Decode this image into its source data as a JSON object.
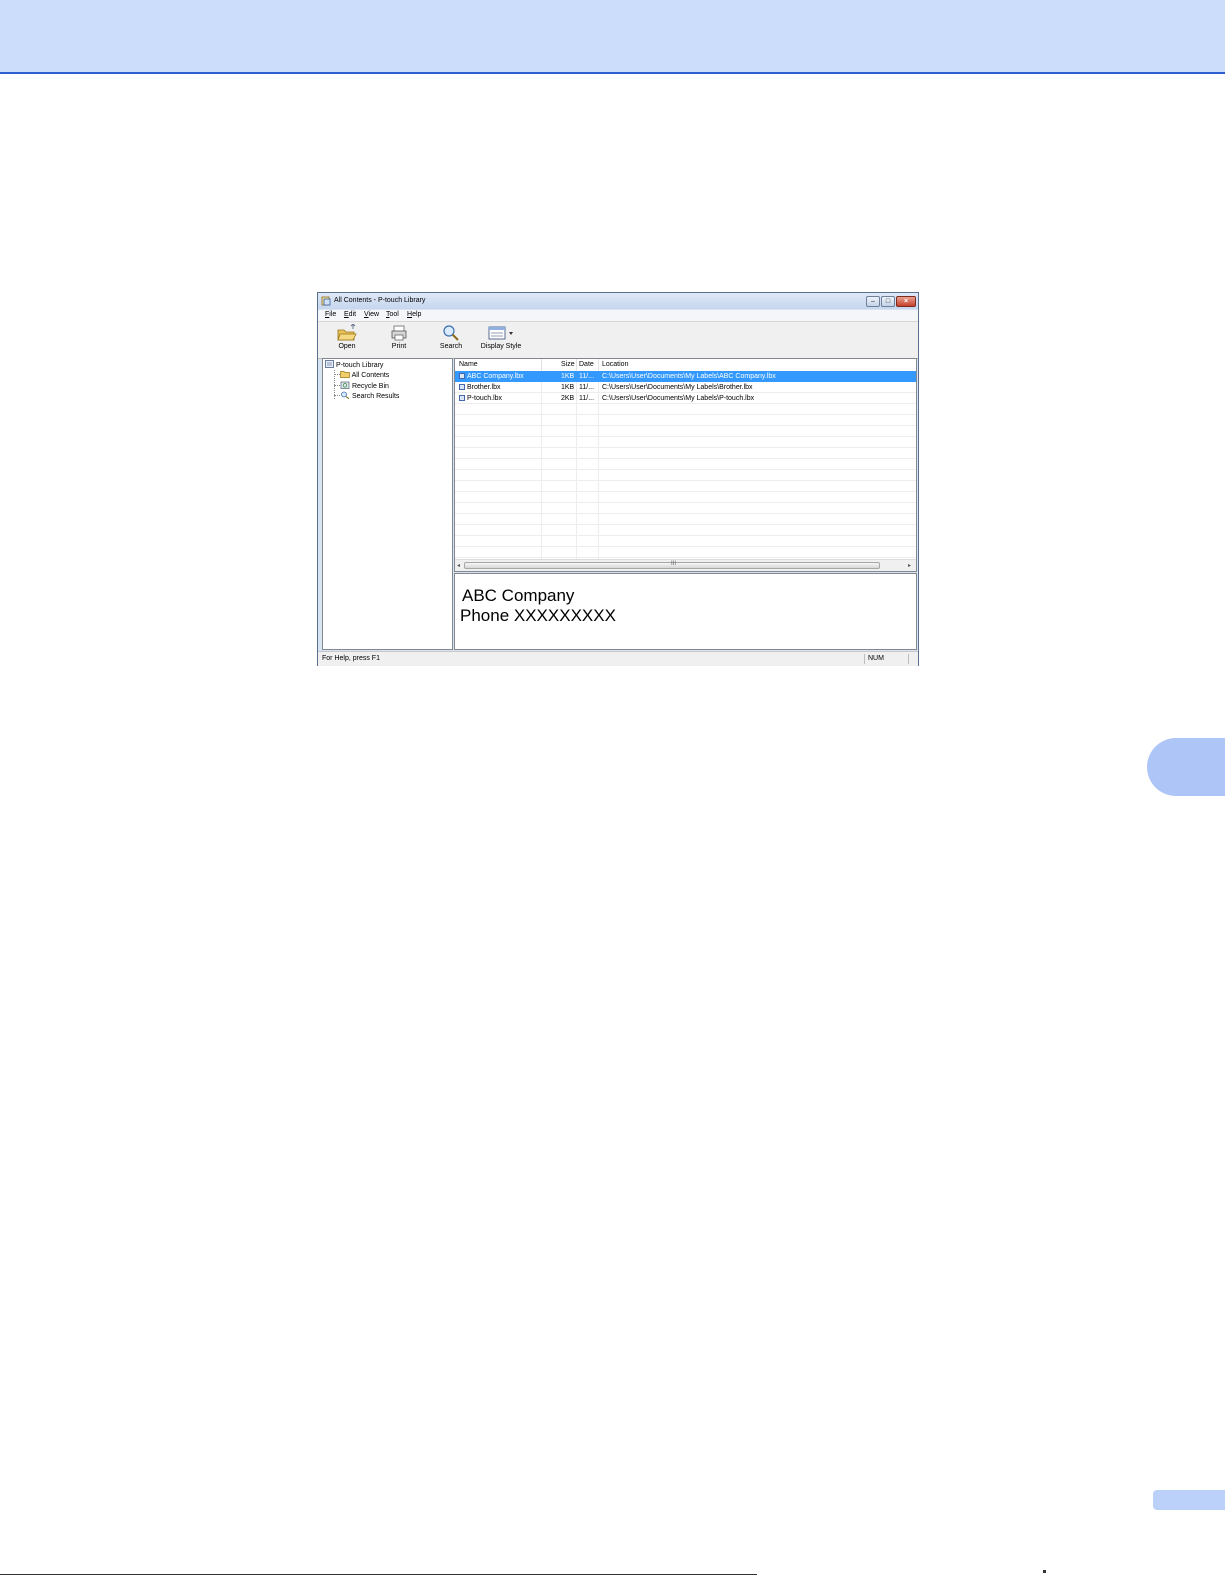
{
  "window": {
    "title": "All Contents - P-touch Library"
  },
  "menu": [
    {
      "key": "F",
      "rest": "ile"
    },
    {
      "key": "E",
      "rest": "dit"
    },
    {
      "key": "V",
      "rest": "iew"
    },
    {
      "key": "T",
      "rest": "ool"
    },
    {
      "key": "H",
      "rest": "elp"
    }
  ],
  "toolbar": {
    "open_label": "Open",
    "print_label": "Print",
    "search_label": "Search",
    "display_style_label": "Display Style"
  },
  "tree": {
    "root": "P-touch Library",
    "items": [
      {
        "label": "All Contents",
        "icon": "folder-icon"
      },
      {
        "label": "Recycle Bin",
        "icon": "recycle-bin-icon"
      },
      {
        "label": "Search Results",
        "icon": "search-icon"
      }
    ]
  },
  "list": {
    "columns": [
      "Name",
      "Size",
      "Date",
      "Location"
    ],
    "rows": [
      {
        "name": "ABC Company.lbx",
        "size": "1KB",
        "date": "11/...",
        "location": "C:\\Users\\User\\Documents\\My Labels\\ABC Company.lbx",
        "selected": true
      },
      {
        "name": "Brother.lbx",
        "size": "1KB",
        "date": "11/...",
        "location": "C:\\Users\\User\\Documents\\My Labels\\Brother.lbx",
        "selected": false
      },
      {
        "name": "P-touch.lbx",
        "size": "2KB",
        "date": "11/...",
        "location": "C:\\Users\\User\\Documents\\My Labels\\P-touch.lbx",
        "selected": false
      }
    ],
    "scroll_grip": "III"
  },
  "preview": {
    "line1": "ABC Company",
    "line2": "Phone XXXXXXXXX"
  },
  "statusbar": {
    "help_text": "For Help, press F1",
    "num_indicator": "NUM"
  },
  "colors": {
    "header_band": "#ccdcfb",
    "header_rule": "#2f5fd1",
    "selection": "#3399ff",
    "side_tab": "#aec6f7"
  }
}
